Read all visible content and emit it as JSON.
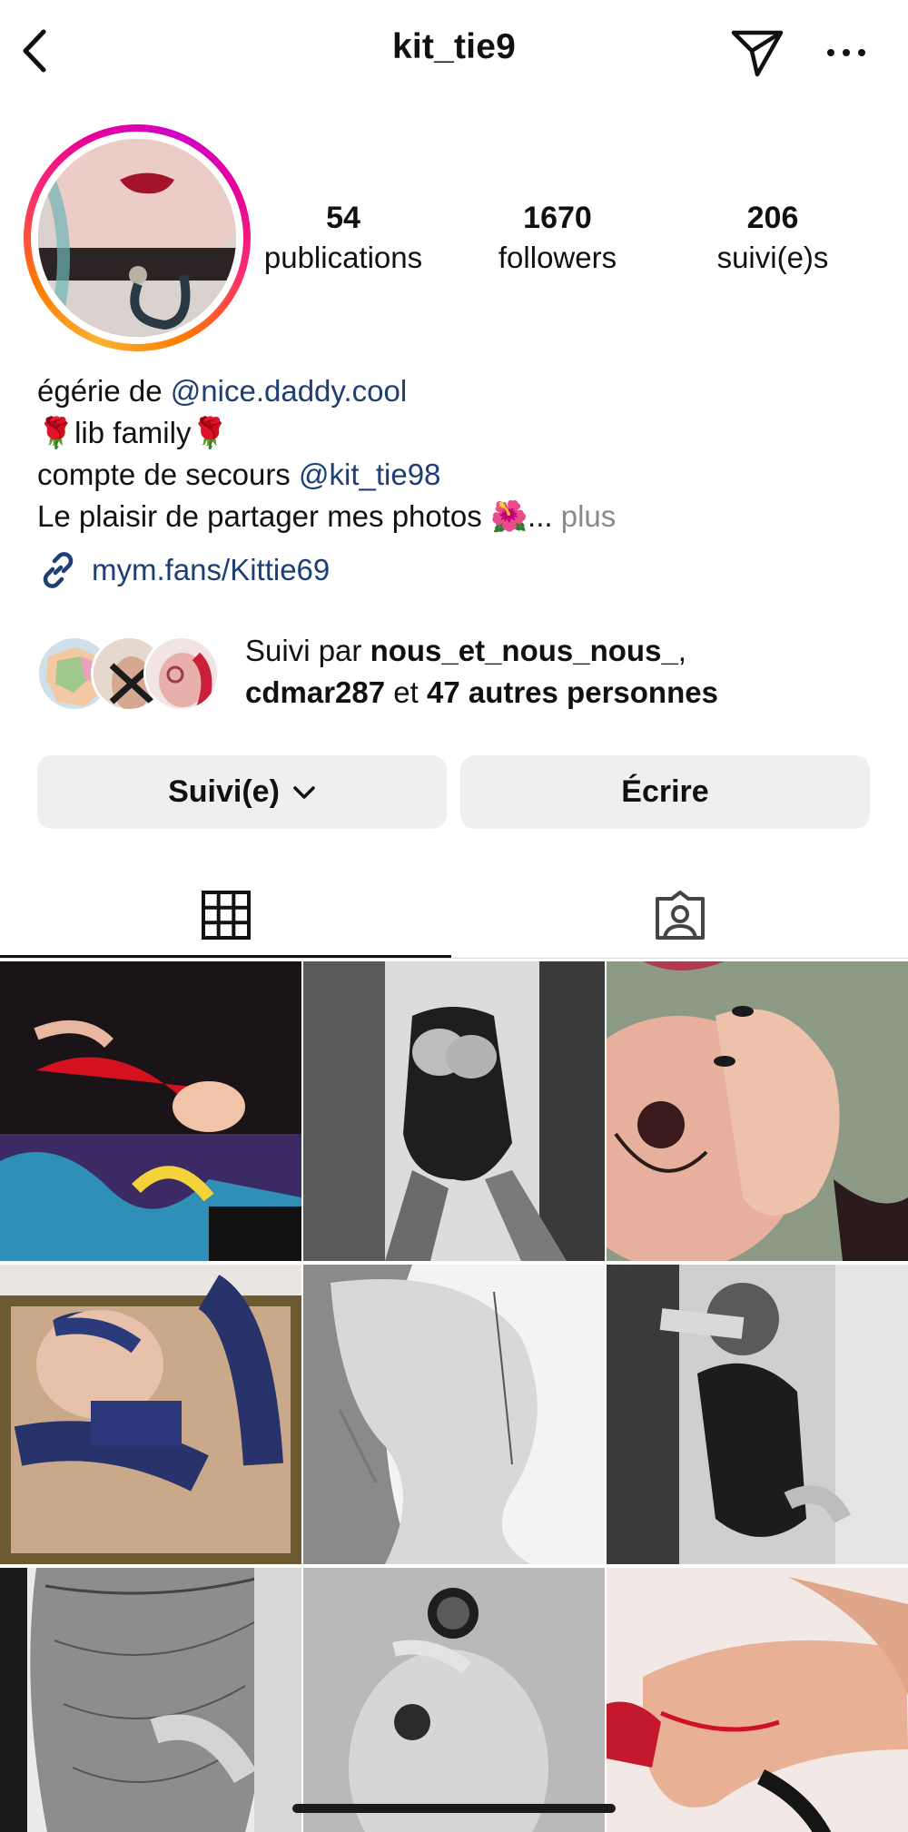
{
  "header": {
    "username": "kit_tie9",
    "icons": {
      "back": "chevron-left-icon",
      "send": "paper-plane-icon",
      "more": "more-horizontal-icon"
    }
  },
  "stats": [
    {
      "value": "54",
      "label": "publications"
    },
    {
      "value": "1670",
      "label": "followers"
    },
    {
      "value": "206",
      "label": "suivi(e)s"
    }
  ],
  "bio": {
    "line1_prefix": "égérie de ",
    "line1_mention": "@nice.daddy.cool",
    "line2_text": "lib family",
    "line2_emoji": "🌹",
    "line3_prefix": "compte de secours ",
    "line3_mention": "@kit_tie98",
    "line4_text": "Le plaisir de partager mes photos ",
    "line4_emoji": "🌺",
    "line4_ellipsis": "... ",
    "more_label": "plus"
  },
  "external_link": {
    "text": "mym.fans/Kittie69",
    "icon": "link-icon"
  },
  "followed_by": {
    "prefix": "Suivi par ",
    "user1": "nous_et_nous_nous_",
    "sep": ",",
    "user2": "cdmar287",
    "conj": " et ",
    "others": "47 autres personnes"
  },
  "actions": {
    "follow_label": "Suivi(e)",
    "message_label": "Écrire"
  },
  "tabs": [
    {
      "name": "grid",
      "icon": "grid-icon",
      "active": true
    },
    {
      "name": "tagged",
      "icon": "tagged-person-icon",
      "active": false
    }
  ],
  "colors": {
    "link": "#1d3f73",
    "button_bg": "#efefef",
    "muted": "#8a8a8a"
  }
}
